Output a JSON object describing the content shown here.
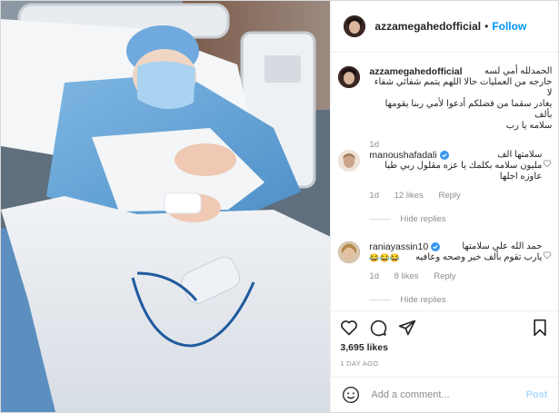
{
  "post": {
    "image_alt": "",
    "username": "azzamegahedofficial",
    "follow_label": "Follow",
    "dot": "•",
    "caption_lines": [
      "الحمدلله أمي لسه",
      "خارجه من العمليات حالا اللهم يتمم شفائي شفاء لا",
      "يغادر سقما من فضلكم أدعوا لأمي ربنا يقومها بألف",
      "سلامه يا رب"
    ],
    "caption_age": "1d",
    "likes": "3,695 likes",
    "date": "1 DAY AGO"
  },
  "comments": [
    {
      "username": "manoushafadali",
      "verified": true,
      "lines": [
        "سلامتها الف",
        "مليون سلامه بكلمك يا عزه مقلول ربي طيا",
        "عاوزه اجلها"
      ],
      "age": "1d",
      "likes": "12 likes",
      "reply": "Reply",
      "hide_replies": "Hide replies"
    },
    {
      "username": "raniayassin10",
      "verified": true,
      "lines": [
        "حمد الله علي سلامتها",
        "يارب تقوم بألف خير وصحه وعافيه",
        "😂😂😂"
      ],
      "age": "1d",
      "likes": "8 likes",
      "reply": "Reply",
      "hide_replies": "Hide replies"
    }
  ],
  "actions": {
    "like_icon": "heart-outline-icon",
    "comment_icon": "comment-bubble-icon",
    "share_icon": "paper-plane-icon",
    "save_icon": "bookmark-icon"
  },
  "add_comment": {
    "placeholder": "Add a comment...",
    "post_label": "Post",
    "emoji_icon": "smiley-icon"
  },
  "colors": {
    "accent": "#0095f6",
    "muted": "#8e8e8e",
    "text": "#262626",
    "border": "#efefef",
    "post_disabled": "#b3dbff"
  }
}
